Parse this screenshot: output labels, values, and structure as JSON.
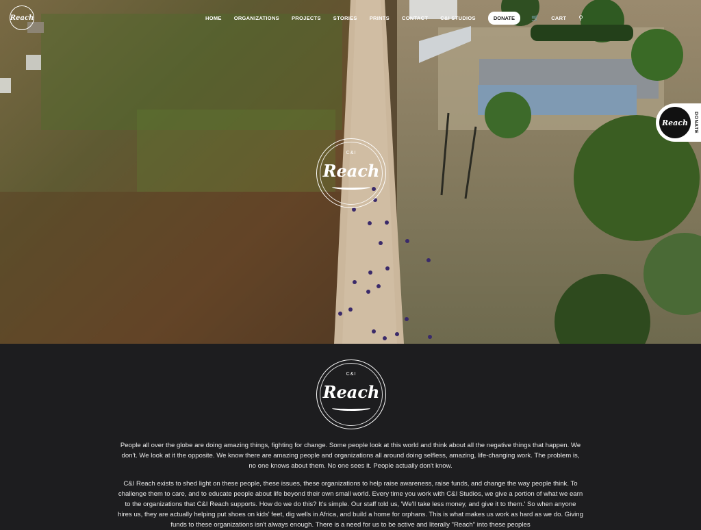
{
  "nav": {
    "logo_text": "Reach",
    "links": [
      "HOME",
      "ORGANIZATIONS",
      "PROJECTS",
      "STORIES",
      "PRINTS",
      "CONTACT",
      "C&I STUDIOS"
    ],
    "donate_label": "DONATE",
    "cart_label": "CART",
    "cart_icon": "cart-icon",
    "search_icon": "search-icon"
  },
  "side_donate": {
    "badge_text": "Reach",
    "label": "DONATE"
  },
  "hero": {
    "emblem_small": "C&I",
    "emblem_word": "Reach"
  },
  "content": {
    "emblem_small": "C&I",
    "emblem_word": "Reach",
    "paragraph_1": "People all over the globe are doing amazing things, fighting for change. Some people look at this world and think about all the negative things that happen. We don't. We look at it the opposite. We know there are amazing people and organizations all around doing selfless, amazing, life-changing work. The problem is, no one knows about them. No one sees it. People actually don't know.",
    "paragraph_2": "C&I Reach exists to shed light on these people, these issues, these organizations to help raise awareness, raise funds, and change the way people think. To challenge them to care, and to educate people about life beyond their own small world. Every time you work with C&I Studios, we give a portion of what we earn to the organizations that C&I Reach supports. How do we do this? It's simple. Our staff told us, 'We'll take less money, and give it to them.' So when anyone hires us, they are actually helping put shoes on kids' feet, dig wells in Africa, and build a home for orphans. This is what makes us work as hard as we do. Giving funds to these organizations isn't always enough. There is a need for us to be active and literally \"Reach\" into these peoples"
  },
  "colors": {
    "page_bg": "#1d1d1f",
    "text": "#eaeaea",
    "road": "#cbb79c",
    "grass": "#6b5a3a"
  }
}
